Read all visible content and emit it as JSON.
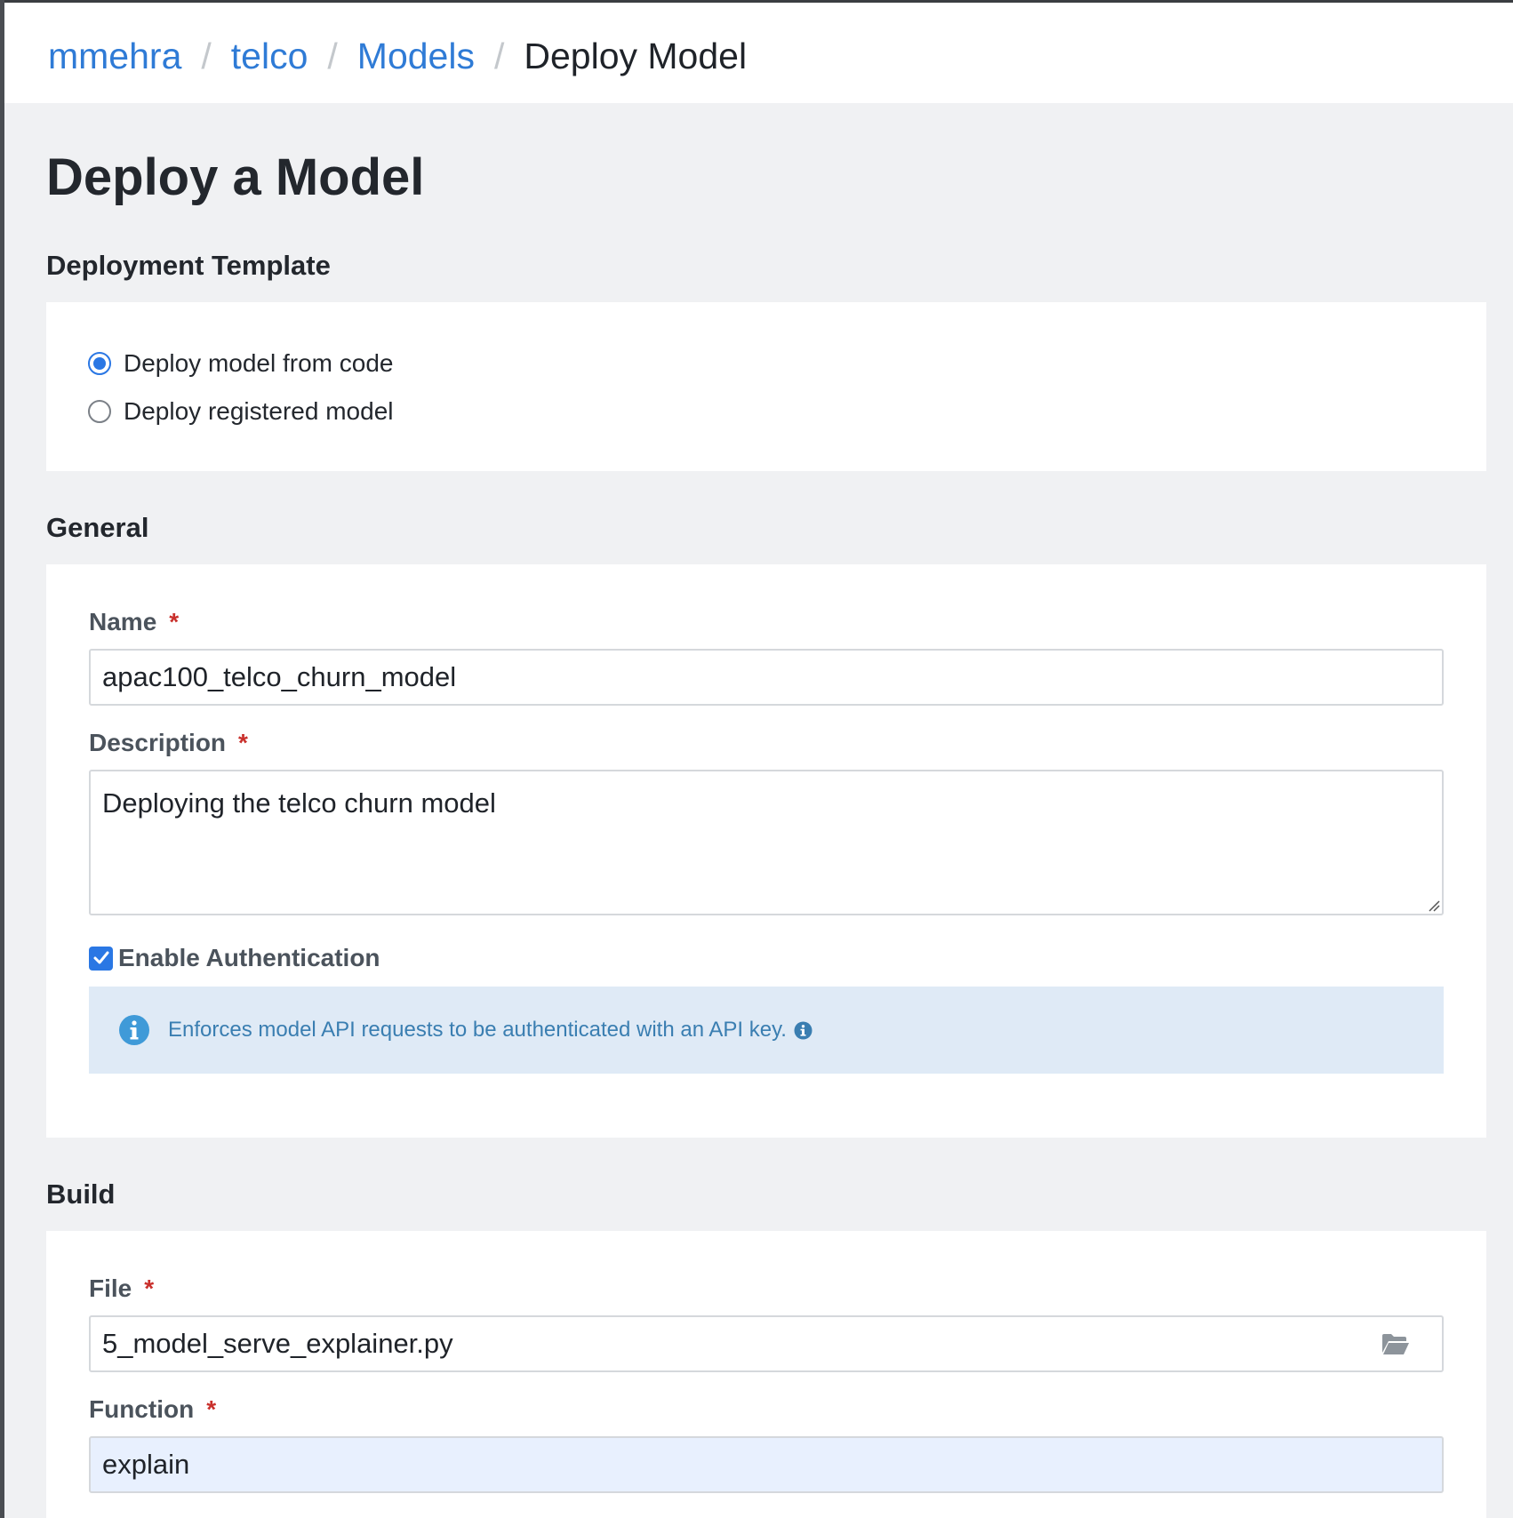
{
  "breadcrumb": {
    "items": [
      "mmehra",
      "telco",
      "Models"
    ],
    "separator": "/",
    "current": "Deploy Model"
  },
  "page": {
    "title": "Deploy a Model"
  },
  "deployment_template": {
    "heading": "Deployment Template",
    "options": [
      {
        "label": "Deploy model from code",
        "selected": true
      },
      {
        "label": "Deploy registered model",
        "selected": false
      }
    ]
  },
  "general": {
    "heading": "General",
    "name_label": "Name",
    "name_value": "apac100_telco_churn_model",
    "description_label": "Description",
    "description_value": "Deploying the telco churn model",
    "required_mark": "*",
    "auth_label": "Enable Authentication",
    "auth_checked": true,
    "auth_info": "Enforces model API requests to be authenticated with an API key."
  },
  "build": {
    "heading": "Build",
    "file_label": "File",
    "file_value": "5_model_serve_explainer.py",
    "function_label": "Function",
    "function_value": "explain"
  },
  "colors": {
    "link": "#2f7bd6",
    "accent": "#2a77e4",
    "required": "#c9302c",
    "info_bg": "#dfeaf6",
    "info_text": "#3a7eb1",
    "page_bg": "#f0f1f3"
  }
}
